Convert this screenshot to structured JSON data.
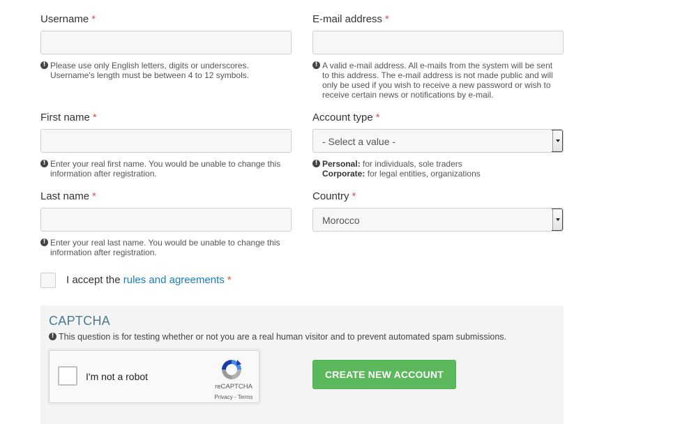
{
  "form": {
    "username": {
      "label": "Username",
      "required_mark": "*",
      "value": "",
      "help": [
        "Please use only English letters, digits or underscores.",
        "Username's length must be between 4 to 12 symbols."
      ]
    },
    "email": {
      "label": "E-mail address",
      "required_mark": "*",
      "value": "",
      "help": [
        "A valid e-mail address. All e-mails from the system will be sent",
        "to this address. The e-mail address is not made public and will",
        "only be used if you wish to receive a new password or wish to",
        "receive certain news or notifications by e-mail."
      ]
    },
    "first_name": {
      "label": "First name",
      "required_mark": "*",
      "value": "",
      "help": [
        "Enter your real first name. You would be unable to change this",
        "information after registration."
      ]
    },
    "account_type": {
      "label": "Account type",
      "required_mark": "*",
      "selected": "- Select a value -",
      "help": {
        "personal_term": "Personal:",
        "personal_text": "for individuals, sole traders",
        "corporate_term": "Corporate:",
        "corporate_text": "for legal entities, organizations"
      }
    },
    "last_name": {
      "label": "Last name",
      "required_mark": "*",
      "value": "",
      "help": [
        "Enter your real last name. You would be unable to change this",
        "information after registration."
      ]
    },
    "country": {
      "label": "Country",
      "required_mark": "*",
      "selected": "Morocco"
    },
    "terms": {
      "prefix": "I accept the",
      "link": "rules and agreements",
      "required_mark": "*",
      "checked": false
    }
  },
  "captcha": {
    "title": "CAPTCHA",
    "description": "This question is for testing whether or not you are a real human visitor and to prevent automated spam submissions.",
    "widget": {
      "label": "I'm not a robot",
      "brand": "reCAPTCHA",
      "privacy": "Privacy",
      "separator": " - ",
      "terms": "Terms"
    }
  },
  "submit_label": "CREATE NEW ACCOUNT",
  "colors": {
    "required": "#d9534f",
    "link": "#1a7bbf",
    "button": "#5cb85c",
    "captcha_title": "#4a7a8c"
  }
}
